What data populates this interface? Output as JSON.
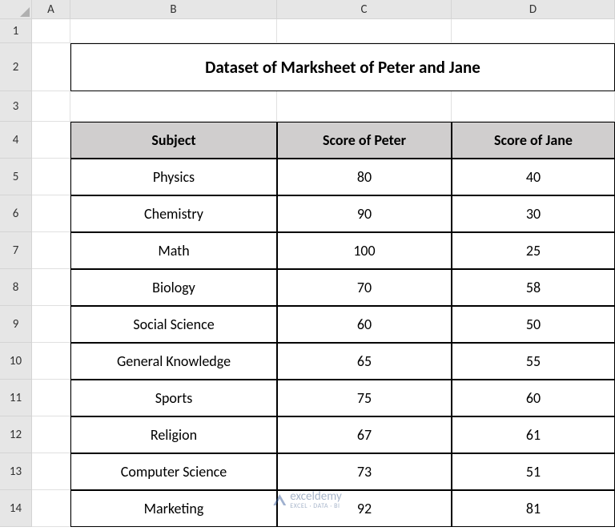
{
  "columns": [
    "A",
    "B",
    "C",
    "D"
  ],
  "rows": [
    "1",
    "2",
    "3",
    "4",
    "5",
    "6",
    "7",
    "8",
    "9",
    "10",
    "11",
    "12",
    "13",
    "14"
  ],
  "title": "Dataset of Marksheet of Peter and Jane",
  "headers": {
    "subject": "Subject",
    "peter": "Score of Peter",
    "jane": "Score of Jane"
  },
  "data": [
    {
      "subject": "Physics",
      "peter": "80",
      "jane": "40"
    },
    {
      "subject": "Chemistry",
      "peter": "90",
      "jane": "30"
    },
    {
      "subject": "Math",
      "peter": "100",
      "jane": "25"
    },
    {
      "subject": "Biology",
      "peter": "70",
      "jane": "58"
    },
    {
      "subject": "Social Science",
      "peter": "60",
      "jane": "50"
    },
    {
      "subject": "General Knowledge",
      "peter": "65",
      "jane": "55"
    },
    {
      "subject": "Sports",
      "peter": "75",
      "jane": "60"
    },
    {
      "subject": "Religion",
      "peter": "67",
      "jane": "61"
    },
    {
      "subject": "Computer Science",
      "peter": "73",
      "jane": "51"
    },
    {
      "subject": "Marketing",
      "peter": "92",
      "jane": "81"
    }
  ],
  "watermark": {
    "brand": "exceldemy",
    "tagline": "EXCEL · DATA · BI"
  }
}
